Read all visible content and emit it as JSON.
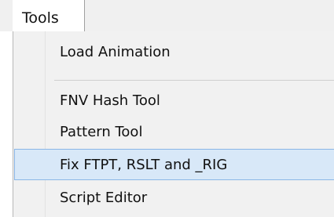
{
  "menubar": {
    "tools_label": "Tools"
  },
  "menu": {
    "items": [
      {
        "label": "Load Animation",
        "highlighted": false
      },
      {
        "label": "FNV Hash Tool",
        "highlighted": false
      },
      {
        "label": "Pattern Tool",
        "highlighted": false
      },
      {
        "label": "Fix FTPT, RSLT and _RIG",
        "highlighted": true
      },
      {
        "label": "Script Editor",
        "highlighted": false
      }
    ]
  },
  "colors": {
    "highlight_background": "#d8e8f8",
    "highlight_border": "#8ab6e6",
    "menu_background": "#f1f1f1"
  }
}
